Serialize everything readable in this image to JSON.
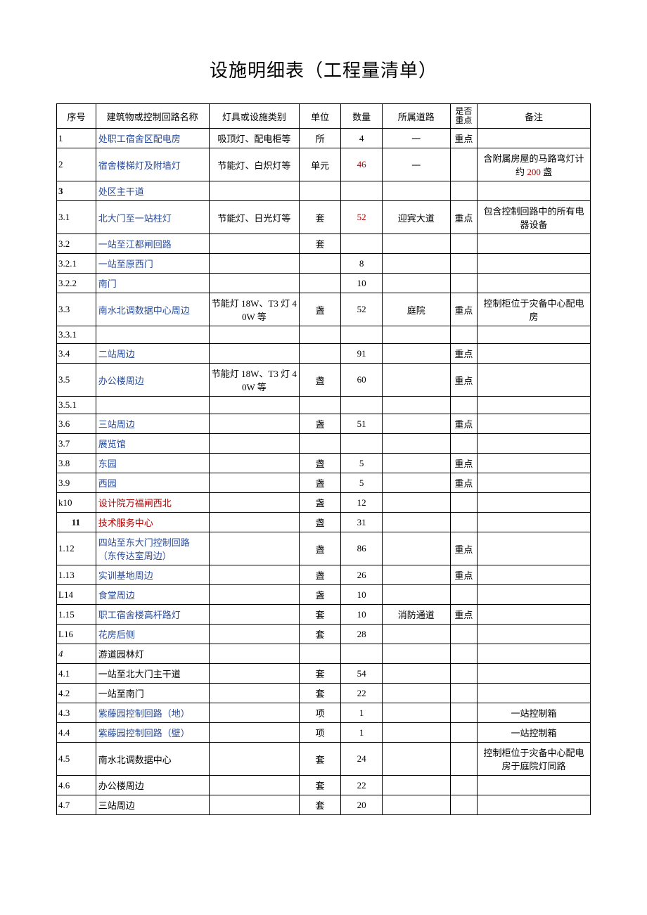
{
  "title": "设施明细表（工程量清单）",
  "headers": {
    "seq": "序号",
    "name": "建筑物或控制回路名称",
    "type": "灯具或设施类别",
    "unit": "单位",
    "qty": "数量",
    "road": "所属道路",
    "key": "是否重点",
    "note": "备注"
  },
  "rows": [
    {
      "seq": "1",
      "name": "处职工宿舍区配电房",
      "name_color": "blue",
      "type": "吸顶灯、配电柜等",
      "unit": "所",
      "qty": "4",
      "road": "一",
      "key": "重点",
      "note": ""
    },
    {
      "seq": "2",
      "name": "宿舍楼梯灯及附墙灯",
      "name_color": "blue",
      "type": "节能灯、白炽灯等",
      "unit": "单元",
      "qty": "46",
      "qty_color": "red",
      "road": "一",
      "key": "",
      "note": "含附属房屋的马路弯灯计约 200 盏",
      "note_has_red": "200"
    },
    {
      "seq": "3",
      "seq_bold": true,
      "name": "处区主干道",
      "name_color": "blue",
      "type": "",
      "unit": "",
      "qty": "",
      "road": "",
      "key": "",
      "note": ""
    },
    {
      "seq": "3.1",
      "name": "北大门至一站柱灯",
      "name_color": "blue",
      "type": "节能灯、日光灯等",
      "unit": "套",
      "qty": "52",
      "qty_color": "red",
      "road": "迎宾大道",
      "key": "重点",
      "note": "包含控制回路中的所有电器设备"
    },
    {
      "seq": "3.2",
      "name": "一站至江都闸回路",
      "name_color": "blue",
      "type": "",
      "unit": "套",
      "qty": "",
      "road": "",
      "key": "",
      "note": ""
    },
    {
      "seq": "3.2.1",
      "name": "一站至原西门",
      "name_color": "blue",
      "type": "",
      "unit": "",
      "qty": "8",
      "road": "",
      "key": "",
      "note": ""
    },
    {
      "seq": "3.2.2",
      "name": "南门",
      "name_color": "blue",
      "type": "",
      "unit": "",
      "qty": "10",
      "road": "",
      "key": "",
      "note": ""
    },
    {
      "seq": "3.3",
      "name": "南水北调数据中心周边",
      "name_color": "blue",
      "type": "节能灯 18W、T3 灯 40W 等",
      "unit": "盏",
      "qty": "52",
      "road": "庭院",
      "key": "重点",
      "note": "控制柜位于灾备中心配电房"
    },
    {
      "seq": "3.3.1",
      "name": "",
      "type": "",
      "unit": "",
      "qty": "",
      "road": "",
      "key": "",
      "note": ""
    },
    {
      "seq": "3.4",
      "name": "二站周边",
      "name_color": "blue",
      "type": "",
      "unit": "",
      "qty": "91",
      "road": "",
      "key": "重点",
      "note": ""
    },
    {
      "seq": "3.5",
      "name": "办公楼周边",
      "name_color": "blue",
      "type": "节能灯 18W、T3 灯 40W 等",
      "unit": "盏",
      "qty": "60",
      "road": "",
      "key": "重点",
      "note": ""
    },
    {
      "seq": "3.5.1",
      "name": "",
      "type": "",
      "unit": "",
      "qty": "",
      "road": "",
      "key": "",
      "note": ""
    },
    {
      "seq": "3.6",
      "name": "三站周边",
      "name_color": "blue",
      "type": "",
      "unit": "盏",
      "qty": "51",
      "road": "",
      "key": "重点",
      "note": ""
    },
    {
      "seq": "3.7",
      "name": "展览馆",
      "name_color": "blue",
      "type": "",
      "unit": "",
      "qty": "",
      "road": "",
      "key": "",
      "note": ""
    },
    {
      "seq": "3.8",
      "name": "东园",
      "name_color": "blue",
      "type": "",
      "unit": "盏",
      "qty": "5",
      "road": "",
      "key": "重点",
      "note": ""
    },
    {
      "seq": "3.9",
      "name": "西园",
      "name_color": "blue",
      "type": "",
      "unit": "盏",
      "qty": "5",
      "road": "",
      "key": "重点",
      "note": ""
    },
    {
      "seq": "k10",
      "name": "设计院万福闸西北",
      "name_color": "red",
      "type": "",
      "unit": "盏",
      "qty": "12",
      "road": "",
      "key": "",
      "note": ""
    },
    {
      "seq": "11",
      "seq_bold": true,
      "seq_center": true,
      "name": "技术服务中心",
      "name_color": "red",
      "type": "",
      "unit": "盏",
      "qty": "31",
      "road": "",
      "key": "",
      "note": ""
    },
    {
      "seq": "1.12",
      "name": "四站至东大门控制回路（东传达室周边）",
      "name_color": "blue",
      "type": "",
      "unit": "盏",
      "qty": "86",
      "road": "",
      "key": "重点",
      "note": ""
    },
    {
      "seq": "1.13",
      "name": "实训基地周边",
      "name_color": "blue",
      "type": "",
      "unit": "盏",
      "qty": "26",
      "road": "",
      "key": "重点",
      "note": ""
    },
    {
      "seq": "L14",
      "name": "食堂周边",
      "name_color": "blue",
      "type": "",
      "unit": "盏",
      "qty": "10",
      "road": "",
      "key": "",
      "note": ""
    },
    {
      "seq": "1.15",
      "name": "职工宿舍楼高杆路灯",
      "name_color": "blue",
      "type": "",
      "unit": "套",
      "qty": "10",
      "road": "消防通道",
      "key": "重点",
      "note": ""
    },
    {
      "seq": "L16",
      "name": "花房后侧",
      "name_color": "blue",
      "type": "",
      "unit": "套",
      "qty": "28",
      "road": "",
      "key": "",
      "note": ""
    },
    {
      "seq": "4",
      "seq_italic": true,
      "name": "游道园林灯",
      "name_color": "black",
      "type": "",
      "unit": "",
      "qty": "",
      "road": "",
      "key": "",
      "note": ""
    },
    {
      "seq": "4.1",
      "name": "一站至北大门主干道",
      "name_color": "black",
      "type": "",
      "unit": "套",
      "qty": "54",
      "road": "",
      "key": "",
      "note": ""
    },
    {
      "seq": "4.2",
      "name": "一站至南门",
      "name_color": "black",
      "type": "",
      "unit": "套",
      "qty": "22",
      "road": "",
      "key": "",
      "note": ""
    },
    {
      "seq": "4.3",
      "name": "紫藤园控制回路（地）",
      "name_color": "blue",
      "type": "",
      "unit": "项",
      "qty": "1",
      "road": "",
      "key": "",
      "note": "一站控制箱"
    },
    {
      "seq": "4.4",
      "name": "紫藤园控制回路（壁）",
      "name_color": "blue",
      "type": "",
      "unit": "项",
      "qty": "1",
      "road": "",
      "key": "",
      "note": "一站控制箱"
    },
    {
      "seq": "4.5",
      "name": "南水北调数据中心",
      "name_color": "black",
      "type": "",
      "unit": "套",
      "qty": "24",
      "road": "",
      "key": "",
      "note": "控制柜位于灾备中心配电房于庭院灯同路"
    },
    {
      "seq": "4.6",
      "name": "办公楼周边",
      "name_color": "black",
      "type": "",
      "unit": "套",
      "qty": "22",
      "road": "",
      "key": "",
      "note": ""
    },
    {
      "seq": "4.7",
      "name": "三站周边",
      "name_color": "black",
      "type": "",
      "unit": "套",
      "qty": "20",
      "road": "",
      "key": "",
      "note": ""
    }
  ]
}
